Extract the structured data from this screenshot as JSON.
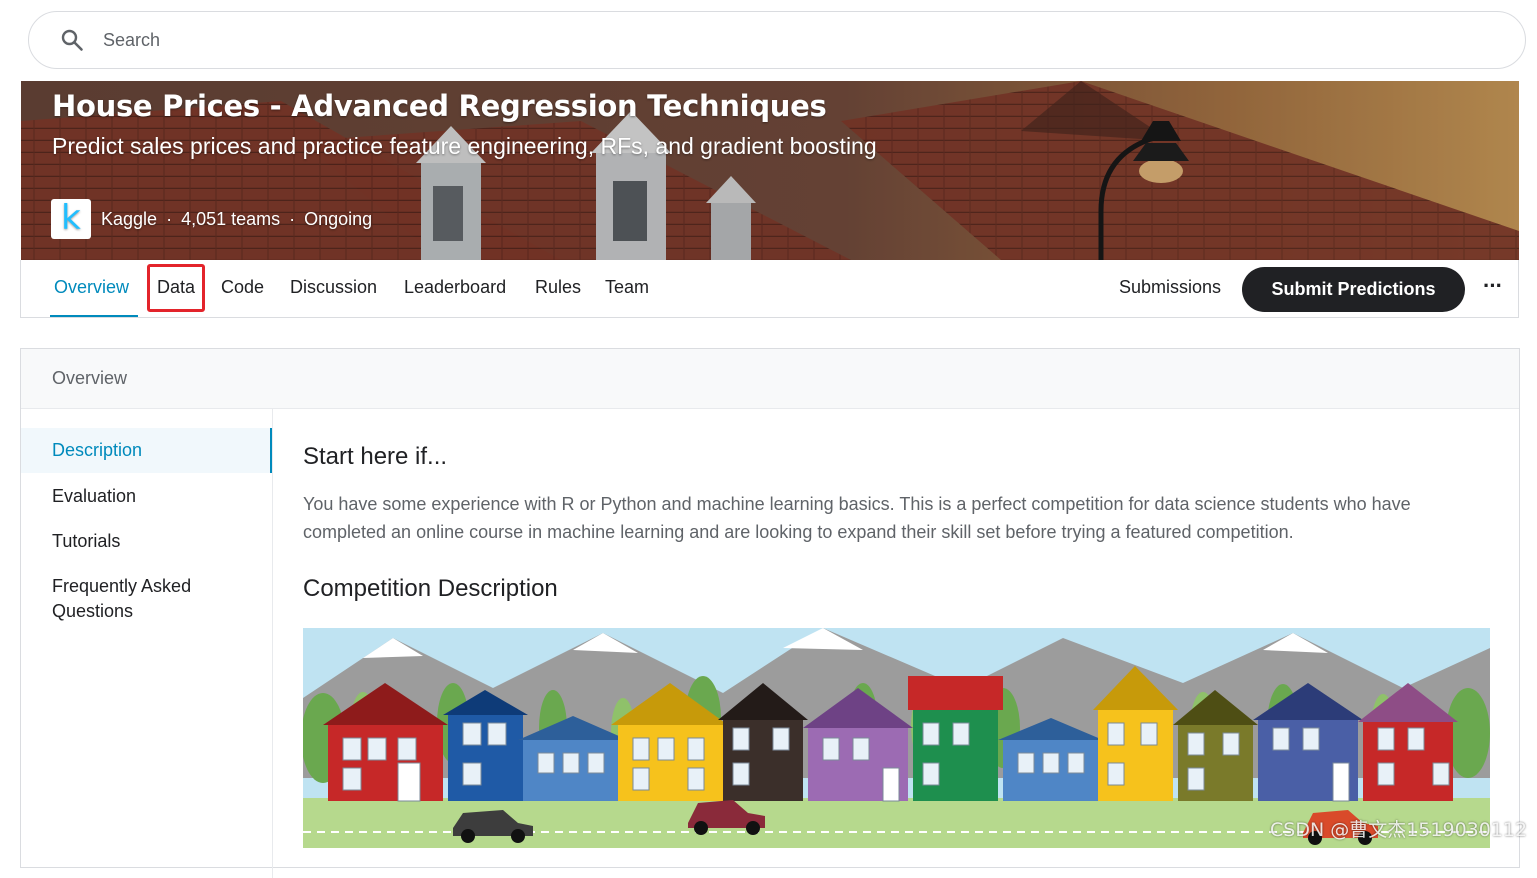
{
  "search": {
    "placeholder": "Search"
  },
  "banner": {
    "title": "House Prices - Advanced Regression Techniques",
    "subtitle": "Predict sales prices and practice feature engineering, RFs, and gradient boosting",
    "logo_letter": "k",
    "host": "Kaggle",
    "teams": "4,051 teams",
    "status": "Ongoing"
  },
  "tabs": [
    {
      "label": "Overview",
      "active": true
    },
    {
      "label": "Data",
      "highlighted": true
    },
    {
      "label": "Code"
    },
    {
      "label": "Discussion"
    },
    {
      "label": "Leaderboard"
    },
    {
      "label": "Rules"
    },
    {
      "label": "Team"
    }
  ],
  "actions": {
    "submissions": "Submissions",
    "submit": "Submit Predictions",
    "more": "···"
  },
  "overview": {
    "header": "Overview",
    "sidebar": [
      {
        "label": "Description",
        "active": true
      },
      {
        "label": "Evaluation"
      },
      {
        "label": "Tutorials"
      },
      {
        "label": "Frequently Asked Questions"
      }
    ],
    "heading1": "Start here if...",
    "paragraph": "You have some experience with R or Python and machine learning basics. This is a perfect competition for data science students who have completed an online course in machine learning and are looking to expand their skill set before trying a featured competition.",
    "heading2": "Competition Description"
  },
  "watermark": "CSDN @曹文杰1519030112",
  "colors": {
    "accent": "#008abc",
    "highlight_box": "#e3242b",
    "button_dark": "#202124",
    "kaggle_blue": "#20beff"
  }
}
